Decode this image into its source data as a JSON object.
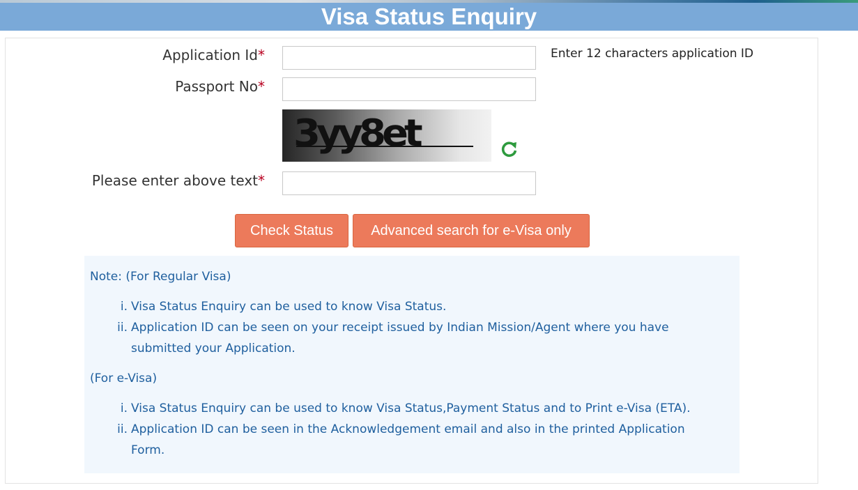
{
  "page": {
    "title": "Visa Status Enquiry"
  },
  "form": {
    "application_id_label": "Application Id",
    "passport_no_label": "Passport No",
    "captcha_input_label": "Please enter above text",
    "required_marker": "*",
    "application_id_value": "",
    "passport_no_value": "",
    "captcha_input_value": "",
    "application_id_hint": "Enter 12 characters application ID"
  },
  "captcha": {
    "text": "3yy8et",
    "refresh_icon": "refresh-icon",
    "refresh_color": "#2e9b3e"
  },
  "buttons": {
    "check_status": "Check Status",
    "advanced_search": "Advanced search for e-Visa only"
  },
  "notes": {
    "regular_heading": "Note: (For Regular Visa)",
    "regular_items": [
      {
        "num": "i.",
        "text": "Visa Status Enquiry can be used to know Visa Status."
      },
      {
        "num": "ii.",
        "text": "Application ID can be seen on your receipt issued by Indian Mission/Agent where you have",
        "text_cont": "submitted your Application."
      }
    ],
    "evisa_heading": "(For e-Visa)",
    "evisa_items": [
      {
        "num": "i.",
        "text": "Visa Status Enquiry can be used to know Visa Status,Payment Status and to Print e-Visa (ETA)."
      },
      {
        "num": "ii.",
        "text": "Application ID can be seen in the Acknowledgement email and also in the printed Application",
        "text_cont": "Form."
      }
    ]
  },
  "colors": {
    "title_bar": "#7aa9d8",
    "button": "#ec7a5b",
    "note_text": "#1f5f9e",
    "required": "#b8001f"
  }
}
